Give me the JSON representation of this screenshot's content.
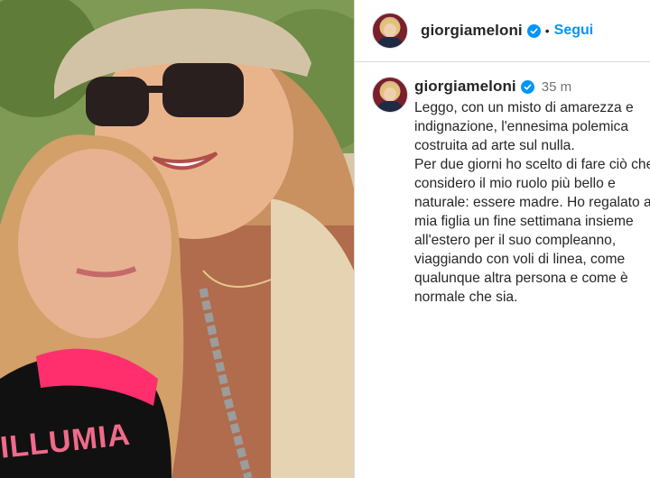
{
  "header": {
    "username": "giorgiameloni",
    "separator": "•",
    "follow_label": "Segui"
  },
  "post": {
    "username": "giorgiameloni",
    "time": "35 m",
    "caption": "Leggo, con un misto di amarezza e indignazione, l'ennesima polemica costruita ad arte sul nulla.\nPer due giorni ho scelto di fare ciò che considero il mio ruolo più bello e naturale: essere madre. Ho regalato a mia figlia un fine settimana insieme all'estero per il suo compleanno, viaggiando con voli di linea, come qualunque altra persona e come è normale che sia."
  },
  "photo": {
    "shirt_text": "ILLUMIA"
  },
  "colors": {
    "link": "#0095f6",
    "verified": "#0095f6",
    "text": "#262626",
    "muted": "#737373"
  },
  "icons": {
    "verified": "verified-badge-icon",
    "avatar": "profile-avatar"
  }
}
